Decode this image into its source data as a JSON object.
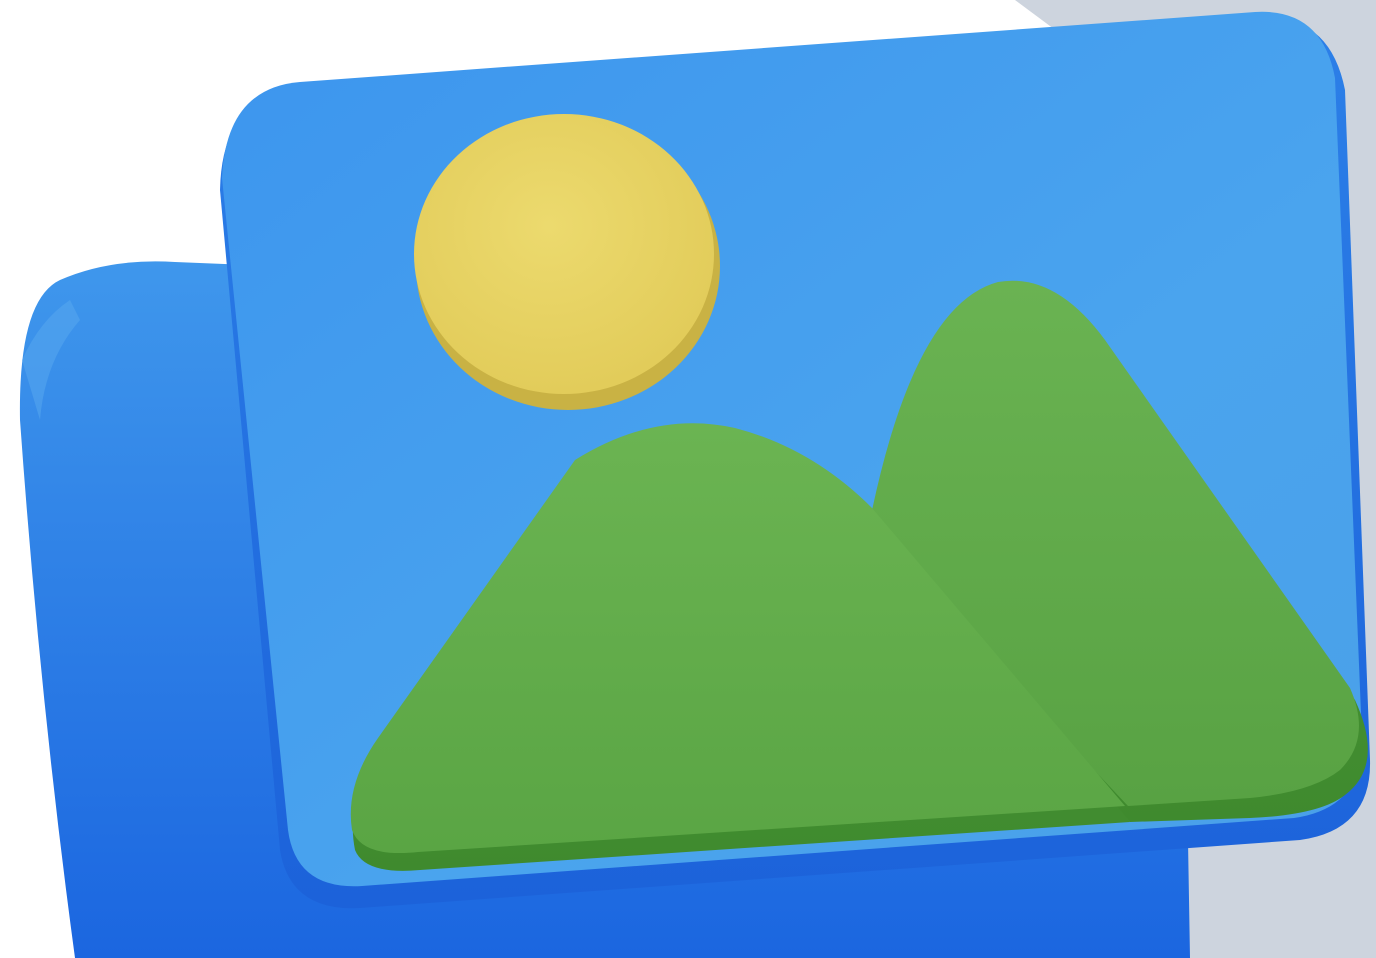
{
  "icon": {
    "name": "image-gallery-icon",
    "colors": {
      "background": "#ffffff",
      "backdrop_gray": "#CDD4DE",
      "card_blue_light": "#4CA6EE",
      "card_blue_dark": "#1E6FE3",
      "sun_yellow": "#E8D465",
      "mountain_green": "#63AC4B",
      "mountain_green_dark": "#4E9A3A"
    }
  }
}
